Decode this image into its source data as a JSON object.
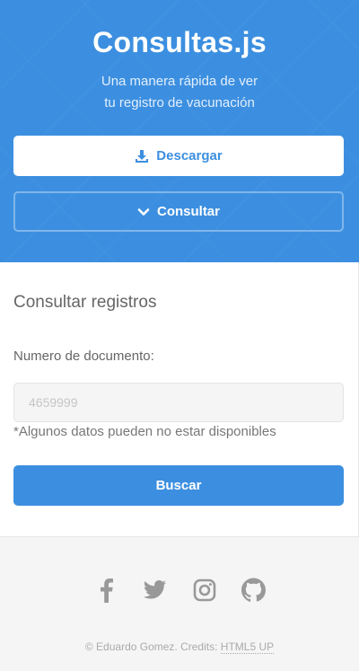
{
  "header": {
    "title": "Consultas.js",
    "tagline_line1": "Una manera rápida de ver",
    "tagline_line2": "tu registro de vacunación",
    "download_label": "Descargar",
    "consult_label": "Consultar"
  },
  "form": {
    "heading": "Consultar registros",
    "document_label": "Numero de documento:",
    "document_placeholder": "4659999",
    "note": "*Algunos datos pueden no estar disponibles",
    "search_label": "Buscar"
  },
  "footer": {
    "social_icons": [
      "facebook-icon",
      "twitter-icon",
      "instagram-icon",
      "github-icon"
    ],
    "copyright_text": "© Eduardo Gomez. Credits: ",
    "credits_link": "HTML5 UP"
  },
  "colors": {
    "accent": "#3c8fe0",
    "icon_gray": "#999999"
  }
}
